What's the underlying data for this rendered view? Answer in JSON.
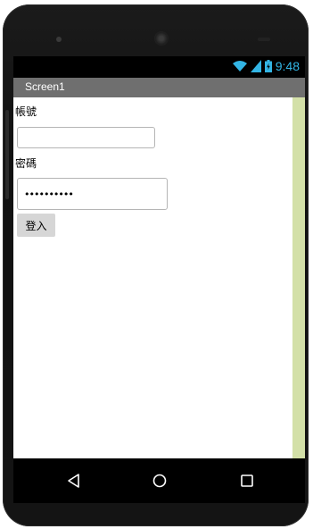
{
  "status_bar": {
    "time": "9:48",
    "icons": [
      "wifi-icon",
      "signal-icon",
      "battery-icon"
    ]
  },
  "app": {
    "title": "Screen1"
  },
  "form": {
    "account_label": "帳號",
    "account_value": "",
    "password_label": "密碼",
    "password_value": "••••••••••",
    "login_button": "登入"
  },
  "nav_bar": {
    "icons": [
      "back-icon",
      "home-icon",
      "recents-icon"
    ]
  },
  "colors": {
    "status_accent": "#33b5e5",
    "title_bar": "#6f6f6f",
    "scroll_strip": "#d3e0a8",
    "button": "#d6d6d6"
  }
}
